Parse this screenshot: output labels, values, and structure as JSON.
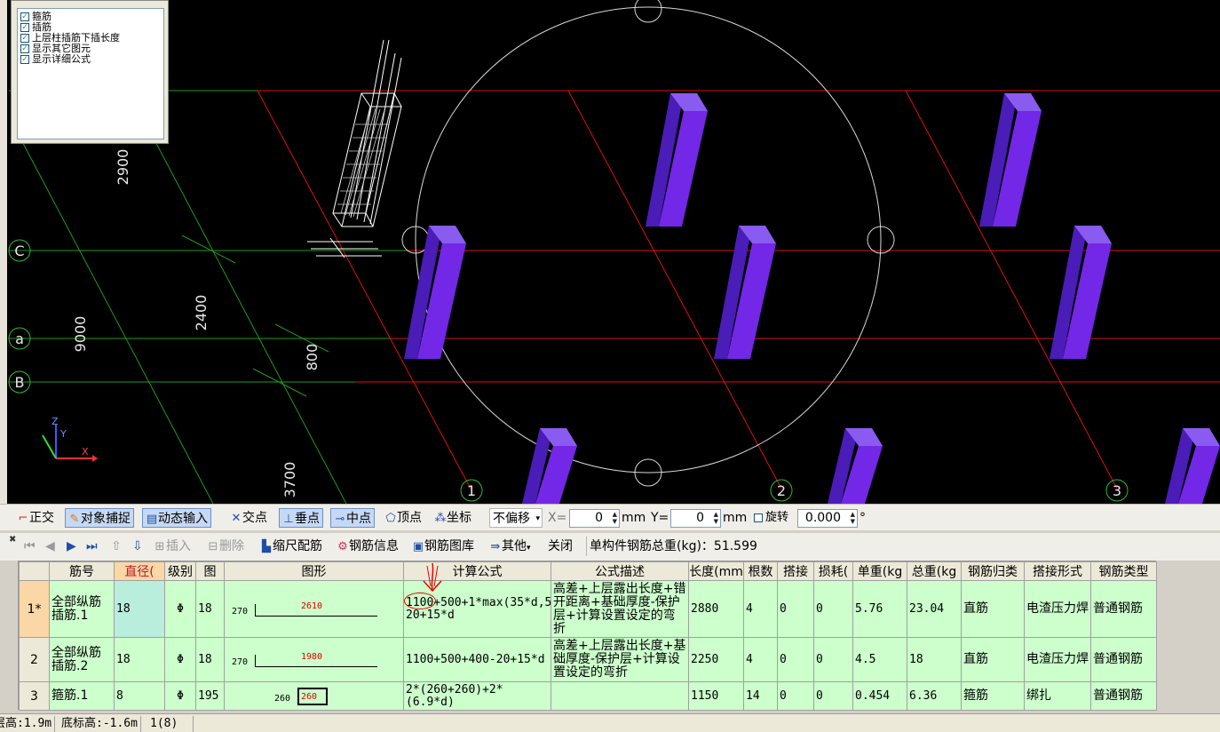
{
  "legend": {
    "items": [
      "箍筋",
      "插筋",
      "上层柱插筋下插长度",
      "显示其它图元",
      "显示详细公式"
    ]
  },
  "view": {
    "axis_labels": {
      "c": "C",
      "a": "a",
      "b": "B",
      "n1": "1",
      "n2": "2",
      "n3": "3"
    },
    "dims": {
      "d2900": "2900",
      "d2400": "2400",
      "d9000": "9000",
      "d800": "800",
      "d3700": "3700"
    },
    "coord": {
      "z": "Z",
      "y": "Y",
      "x": "X"
    }
  },
  "toolbar1": {
    "ortho": "正交",
    "snap": "对象捕捉",
    "dyn": "动态输入",
    "inter": "交点",
    "perp": "垂点",
    "mid": "中点",
    "vertex": "顶点",
    "coord": "坐标",
    "offset": "不偏移",
    "x_label": "X=",
    "x_val": "0",
    "unit1": "mm",
    "y_label": "Y=",
    "y_val": "0",
    "unit2": "mm",
    "rotate": "旋转",
    "rotate_val": "0.000",
    "deg": "°"
  },
  "toolbar2": {
    "insert": "插入",
    "delete": "删除",
    "scale": "缩尺配筋",
    "info": "钢筋信息",
    "lib": "钢筋图库",
    "other": "其他",
    "close": "关闭",
    "total": "单构件钢筋总重(kg)：51.599"
  },
  "table": {
    "headers": [
      "筋号",
      "直径(",
      "级别",
      "图",
      "图形",
      "计算公式",
      "公式描述",
      "长度(mm",
      "根数",
      "搭接",
      "损耗(",
      "单重(kg",
      "总重(kg",
      "钢筋归类",
      "搭接形式",
      "钢筋类型"
    ],
    "rows": [
      {
        "no": "1*",
        "name": "全部纵筋插筋.1",
        "dia": "18",
        "grade": "Φ",
        "fig": "18",
        "shape_left": "270",
        "shape_mid": "2610",
        "formula": "1100+500+1*max(35*d,500)+400-20+15*d",
        "desc": "高差+上层露出长度+错开距离+基础厚度-保护层+计算设置设定的弯折",
        "len": "2880",
        "count": "4",
        "lap": "0",
        "loss": "0",
        "unit_w": "5.76",
        "total_w": "23.04",
        "cat": "直筋",
        "lap_form": "电渣压力焊",
        "type": "普通钢筋"
      },
      {
        "no": "2",
        "name": "全部纵筋插筋.2",
        "dia": "18",
        "grade": "Φ",
        "fig": "18",
        "shape_left": "270",
        "shape_mid": "1980",
        "formula": "1100+500+400-20+15*d",
        "desc": "高差+上层露出长度+基础厚度-保护层+计算设置设定的弯折",
        "len": "2250",
        "count": "4",
        "lap": "0",
        "loss": "0",
        "unit_w": "4.5",
        "total_w": "18",
        "cat": "直筋",
        "lap_form": "电渣压力焊",
        "type": "普通钢筋"
      },
      {
        "no": "3",
        "name": "箍筋.1",
        "dia": "8",
        "grade": "Φ",
        "fig": "195",
        "shape_left": "260",
        "shape_mid": "260",
        "formula": "2*(260+260)+2*(6.9*d)",
        "desc": "",
        "len": "1150",
        "count": "14",
        "lap": "0",
        "loss": "0",
        "unit_w": "0.454",
        "total_w": "6.36",
        "cat": "箍筋",
        "lap_form": "绑扎",
        "type": "普通钢筋"
      }
    ]
  },
  "status": {
    "s1": "层高:1.9m",
    "s2": "底标高:-1.6m",
    "s3": "1(8)"
  }
}
